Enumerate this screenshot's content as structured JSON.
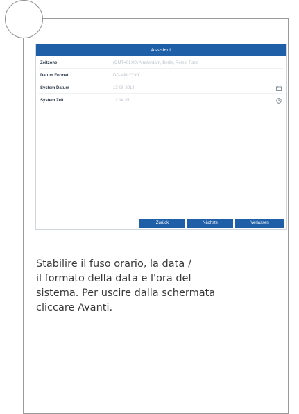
{
  "dialog": {
    "title": "Assistent",
    "rows": [
      {
        "label": "Zeitzone",
        "value": "(GMT+01:00) Amsterdam, Berlin, Rome, Paris",
        "icon": ""
      },
      {
        "label": "Datum Format",
        "value": "DD-MM-YYYY",
        "icon": ""
      },
      {
        "label": "System Datum",
        "value": "13-06-2014",
        "icon": "calendar-icon"
      },
      {
        "label": "System Zeit",
        "value": "12:14:35",
        "icon": "clock-icon"
      }
    ],
    "buttons": {
      "back": "Zurück",
      "next": "Nächste",
      "apply": "Verlassen"
    },
    "accent_color": "#1f5fa8"
  },
  "description": {
    "line1": "Stabilire il fuso orario, la data /",
    "line2": "il formato della data e l'ora del",
    "line3": "sistema. Per uscire dalla schermata",
    "line4": "cliccare Avanti."
  }
}
